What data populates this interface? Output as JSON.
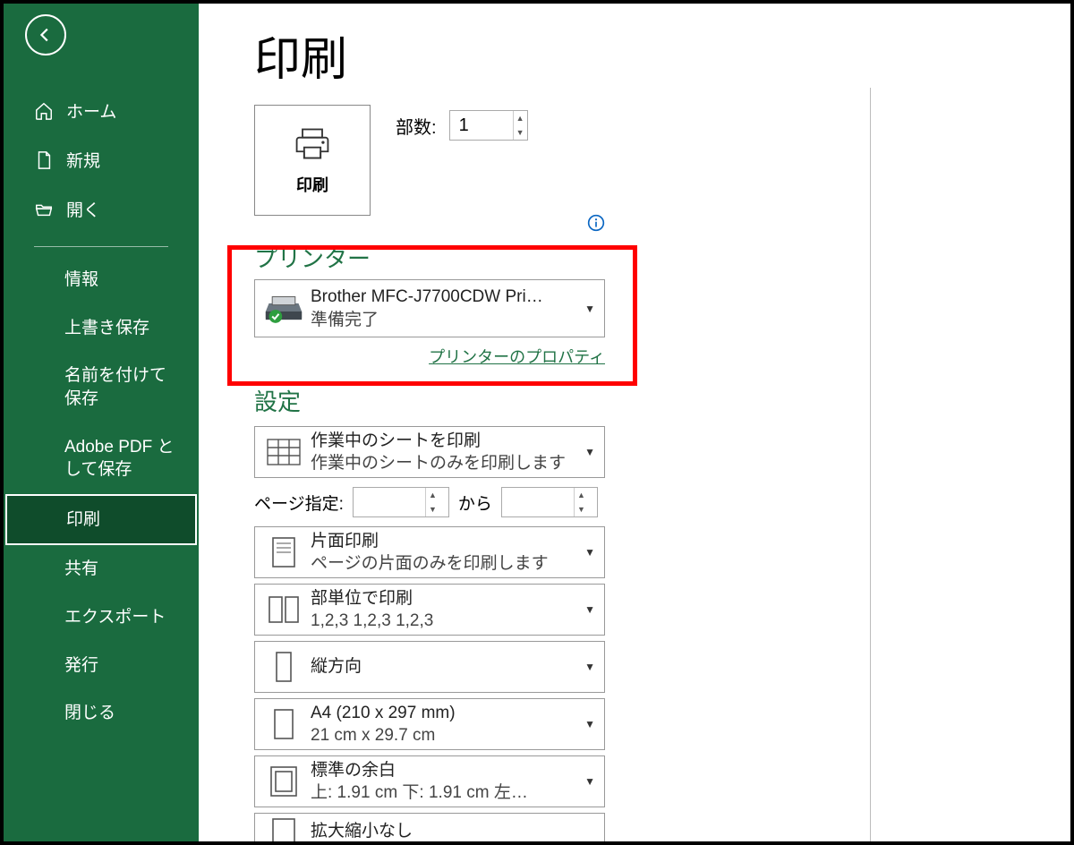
{
  "sidebar": {
    "home": "ホーム",
    "new": "新規",
    "open": "開く",
    "info": "情報",
    "save": "上書き保存",
    "saveas": "名前を付けて保存",
    "adobepdf": "Adobe PDF として保存",
    "print": "印刷",
    "share": "共有",
    "export": "エクスポート",
    "publish": "発行",
    "close": "閉じる"
  },
  "main": {
    "title": "印刷",
    "print_btn": "印刷",
    "copies_label": "部数:",
    "copies_value": "1",
    "printer_section": "プリンター",
    "printer_name": "Brother MFC-J7700CDW Pri…",
    "printer_status": "準備完了",
    "printer_properties": "プリンターのプロパティ",
    "settings_section": "設定",
    "print_area_title": "作業中のシートを印刷",
    "print_area_sub": "作業中のシートのみを印刷します",
    "page_range_label": "ページ指定:",
    "page_from": "",
    "page_to_label": "から",
    "page_to": "",
    "duplex_title": "片面印刷",
    "duplex_sub": "ページの片面のみを印刷します",
    "collate_title": "部単位で印刷",
    "collate_sub": "1,2,3    1,2,3    1,2,3",
    "orientation_title": "縦方向",
    "paper_title": "A4 (210 x 297 mm)",
    "paper_sub": "21 cm x 29.7 cm",
    "margins_title": "標準の余白",
    "margins_sub": "上: 1.91 cm 下: 1.91 cm 左…",
    "scaling_title": "拡大縮小なし"
  }
}
